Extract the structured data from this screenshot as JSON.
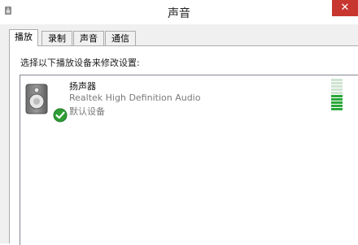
{
  "window": {
    "title": "声音",
    "close_glyph": "✕"
  },
  "tabs": [
    {
      "label": "播放",
      "active": true
    },
    {
      "label": "录制",
      "active": false
    },
    {
      "label": "声音",
      "active": false
    },
    {
      "label": "通信",
      "active": false
    }
  ],
  "playback": {
    "instruction": "选择以下播放设备来修改设置:",
    "devices": [
      {
        "name": "扬声器",
        "description": "Realtek High Definition Audio",
        "status": "默认设备",
        "icon": "speaker-icon",
        "badge": "default-check-icon",
        "level_segments_total": 10,
        "level_segments_active": 5
      }
    ]
  },
  "colors": {
    "close_button": "#c7362f",
    "meter_active": "#2aa83a",
    "meter_inactive": "#cfe4d2",
    "check_badge": "#2f9e35"
  }
}
